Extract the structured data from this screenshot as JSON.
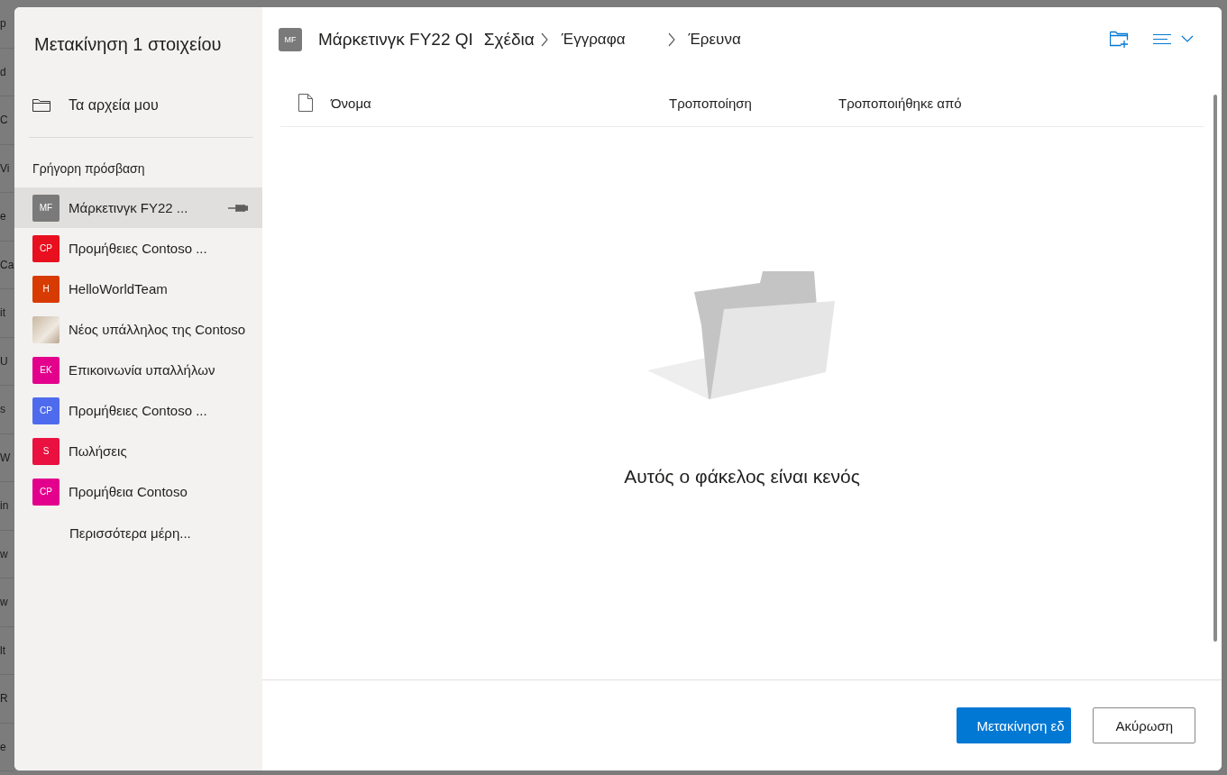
{
  "background_fragments": [
    "p",
    "d",
    "C",
    "Vi",
    "e",
    "Ca",
    "it",
    "U",
    "s",
    "W",
    "in",
    "w",
    "w",
    "lt",
    "R",
    "e"
  ],
  "dialog": {
    "title": "Μετακίνηση 1 στοιχείου",
    "my_files": {
      "label": "Τα αρχεία μου"
    },
    "quick_access": {
      "heading": "Γρήγορη πρόσβαση",
      "items": [
        {
          "kind": "initials",
          "initials": "MF",
          "label": "Μάρκετινγκ FY22 ...",
          "color": "#7a7a7a",
          "selected": true,
          "pinned": true
        },
        {
          "kind": "initials",
          "initials": "CP",
          "label": "Προμήθειες Contoso ...",
          "color": "#e8101f",
          "selected": false,
          "pinned": false
        },
        {
          "kind": "initials",
          "initials": "H",
          "label": "HelloWorldTeam",
          "color": "#d83b01",
          "selected": false,
          "pinned": false
        },
        {
          "kind": "photo",
          "label": "Νέος υπάλληλος της Contoso",
          "selected": false,
          "pinned": false
        },
        {
          "kind": "initials",
          "initials": "EK",
          "label": "Επικοινωνία υπαλλήλων",
          "color": "#e3008c",
          "selected": false,
          "pinned": false
        },
        {
          "kind": "initials",
          "initials": "CP",
          "label": "Προμήθειες Contoso ...",
          "color": "#4f6bed",
          "selected": false,
          "pinned": false
        },
        {
          "kind": "initials",
          "initials": "S",
          "label": "Πωλήσεις",
          "color": "#ea1040",
          "selected": false,
          "pinned": false
        },
        {
          "kind": "initials",
          "initials": "CP",
          "label": "Προμήθεια Contoso",
          "color": "#e3008c",
          "selected": false,
          "pinned": false
        }
      ]
    },
    "more_places": "Περισσότερα μέρη...",
    "breadcrumb": {
      "site_initials": "MF",
      "items": [
        {
          "label": "Μάρκετινγκ FY22 QI",
          "chevron_before": false
        },
        {
          "label": "Σχέδια",
          "chevron_before": false
        },
        {
          "label": "Έγγραφα",
          "chevron_before": true
        },
        {
          "label": "Έρευνα",
          "chevron_before": true
        }
      ]
    },
    "columns": [
      "Όνομα",
      "Τροποποίηση",
      "Τροποποιήθηκε από"
    ],
    "empty_message": "Αυτός ο φάκελος είναι κενός",
    "buttons": [
      {
        "kind": "primary",
        "label": "Μετακίνηση εδ"
      },
      {
        "kind": "secondary",
        "label": "Ακύρωση"
      }
    ]
  }
}
